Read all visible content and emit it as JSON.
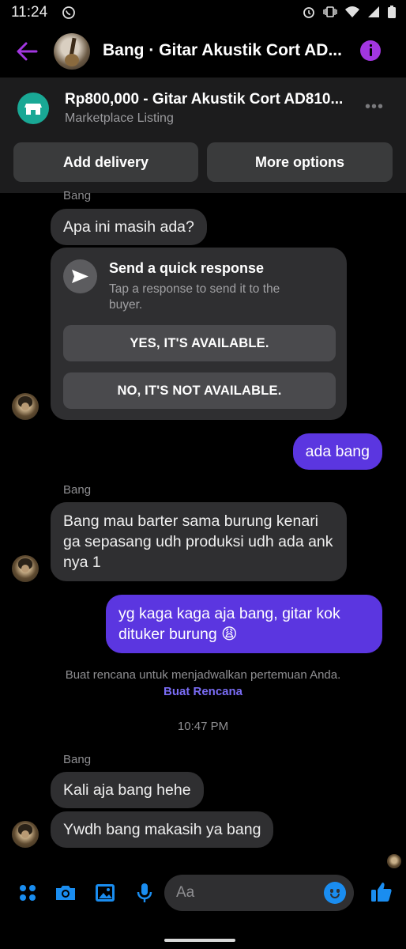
{
  "status_bar": {
    "time": "11:24"
  },
  "header": {
    "title": "Bang · Gitar Akustik Cort AD..."
  },
  "listing": {
    "title": "Rp800,000 - Gitar Akustik Cort AD810...",
    "subtitle": "Marketplace Listing",
    "more_glyph": "•••",
    "add_delivery_label": "Add delivery",
    "more_options_label": "More options"
  },
  "messages": {
    "sender_1": "Bang",
    "msg_1": "Apa ini masih ada?",
    "quick_response": {
      "title": "Send a quick response",
      "subtitle": "Tap a response to send it to the buyer.",
      "option_yes": "YES, IT'S AVAILABLE.",
      "option_no": "NO, IT'S NOT AVAILABLE."
    },
    "out_1": "ada bang",
    "sender_2": "Bang",
    "msg_2": "Bang mau barter sama burung kenari ga sepasang udh produksi udh ada ank nya 1",
    "out_2": "yg kaga kaga aja bang, gitar kok dituker burung 😩",
    "system_text": "Buat rencana untuk menjadwalkan pertemuan Anda.",
    "system_link": "Buat Rencana",
    "timestamp": "10:47 PM",
    "sender_3": "Bang",
    "msg_3": "Kali aja bang hehe",
    "msg_4": "Ywdh bang makasih ya bang"
  },
  "composer": {
    "placeholder": "Aa"
  },
  "colors": {
    "accent_purple": "#a236e0",
    "outgoing_bubble": "#5b36e0",
    "composer_icons": "#1a8df0",
    "marketplace_icon": "#19a895"
  },
  "icons": [
    "back-arrow-icon",
    "info-icon",
    "shop-icon",
    "send-icon",
    "apps-icon",
    "camera-icon",
    "gallery-icon",
    "microphone-icon",
    "emoji-icon",
    "thumbs-up-icon"
  ]
}
